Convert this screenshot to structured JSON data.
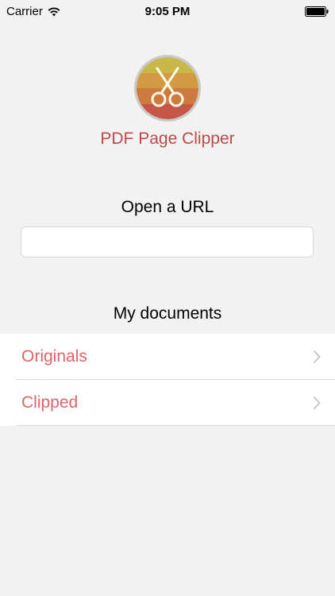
{
  "status_bar": {
    "carrier": "Carrier",
    "time": "9:05 PM"
  },
  "app": {
    "title": "PDF Page Clipper",
    "logo_icon": "scissors-icon",
    "logo_colors": [
      "#c8b84a",
      "#d29a43",
      "#cc7a3e",
      "#c65645"
    ]
  },
  "url_section": {
    "label": "Open a URL",
    "value": "",
    "placeholder": ""
  },
  "documents": {
    "header": "My documents",
    "items": [
      {
        "label": "Originals"
      },
      {
        "label": "Clipped"
      }
    ]
  },
  "colors": {
    "background": "#f2f2f2",
    "accent_title": "#c04848",
    "list_label": "#e0636a"
  }
}
